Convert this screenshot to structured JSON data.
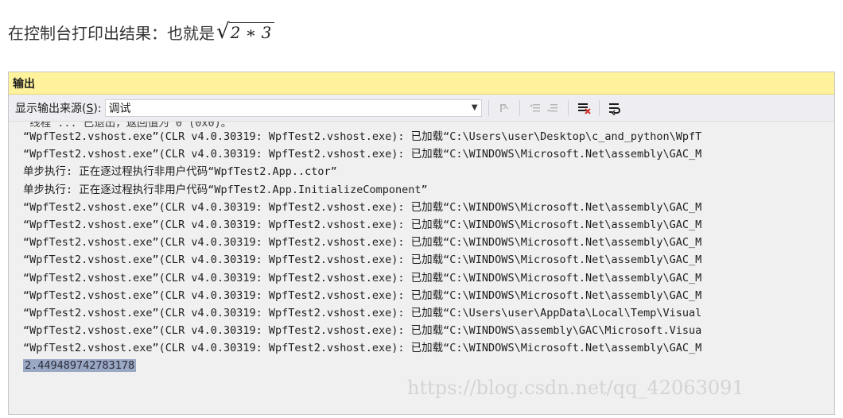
{
  "heading": {
    "text": "在控制台打印出结果：也就是",
    "formula": "2 ∗ 3"
  },
  "panel": {
    "title": "输出",
    "source_label_prefix": "显示输出来源(",
    "source_label_key": "S",
    "source_label_suffix": "):",
    "source_value": "调试"
  },
  "output_lines": [
    "“WpfTest2.vshost.exe”(CLR v4.0.30319: WpfTest2.vshost.exe): 已加载“C:\\Users\\user\\Desktop\\c_and_python\\WpfT",
    "“WpfTest2.vshost.exe”(CLR v4.0.30319: WpfTest2.vshost.exe): 已加载“C:\\WINDOWS\\Microsoft.Net\\assembly\\GAC_M",
    "单步执行: 正在逐过程执行非用户代码“WpfTest2.App..ctor”",
    "单步执行: 正在逐过程执行非用户代码“WpfTest2.App.InitializeComponent”",
    "“WpfTest2.vshost.exe”(CLR v4.0.30319: WpfTest2.vshost.exe): 已加载“C:\\WINDOWS\\Microsoft.Net\\assembly\\GAC_M",
    "“WpfTest2.vshost.exe”(CLR v4.0.30319: WpfTest2.vshost.exe): 已加载“C:\\WINDOWS\\Microsoft.Net\\assembly\\GAC_M",
    "“WpfTest2.vshost.exe”(CLR v4.0.30319: WpfTest2.vshost.exe): 已加载“C:\\WINDOWS\\Microsoft.Net\\assembly\\GAC_M",
    "“WpfTest2.vshost.exe”(CLR v4.0.30319: WpfTest2.vshost.exe): 已加载“C:\\WINDOWS\\Microsoft.Net\\assembly\\GAC_M",
    "“WpfTest2.vshost.exe”(CLR v4.0.30319: WpfTest2.vshost.exe): 已加载“C:\\WINDOWS\\Microsoft.Net\\assembly\\GAC_M",
    "“WpfTest2.vshost.exe”(CLR v4.0.30319: WpfTest2.vshost.exe): 已加载“C:\\WINDOWS\\Microsoft.Net\\assembly\\GAC_M",
    "“WpfTest2.vshost.exe”(CLR v4.0.30319: WpfTest2.vshost.exe): 已加载“C:\\Users\\user\\AppData\\Local\\Temp\\Visual",
    "“WpfTest2.vshost.exe”(CLR v4.0.30319: WpfTest2.vshost.exe): 已加载“C:\\WINDOWS\\assembly\\GAC\\Microsoft.Visua",
    "“WpfTest2.vshost.exe”(CLR v4.0.30319: WpfTest2.vshost.exe): 已加载“C:\\WINDOWS\\Microsoft.Net\\assembly\\GAC_M"
  ],
  "result": "2.449489742783178",
  "watermark": "https://blog.csdn.net/qq_42063091",
  "icons": {
    "find_message": "find-message-icon",
    "prev_message": "previous-message-icon",
    "next_message": "next-message-icon",
    "clear_all": "clear-all-icon",
    "word_wrap": "word-wrap-icon"
  }
}
